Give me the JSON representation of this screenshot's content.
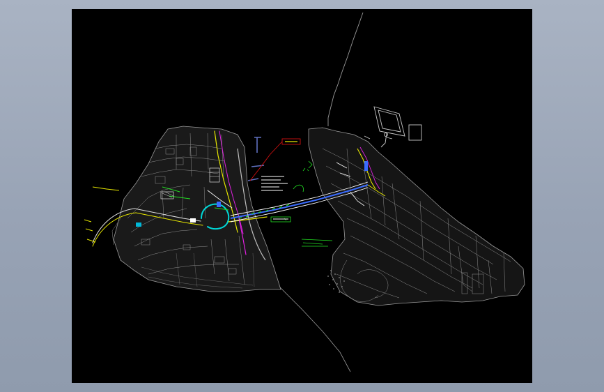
{
  "screen": {
    "background_color": "#a2adbd"
  },
  "cad_viewport": {
    "background_color": "#000000",
    "line_colors": {
      "terrain": "#9a9a9a",
      "road_yellow": "#e8e800",
      "road_green": "#22e022",
      "bridge_blue": "#3a6cff",
      "bridge_white": "#ffffff",
      "callout_red": "#d01010",
      "accent_magenta": "#e020e0",
      "accent_cyan": "#00d8d8"
    }
  }
}
